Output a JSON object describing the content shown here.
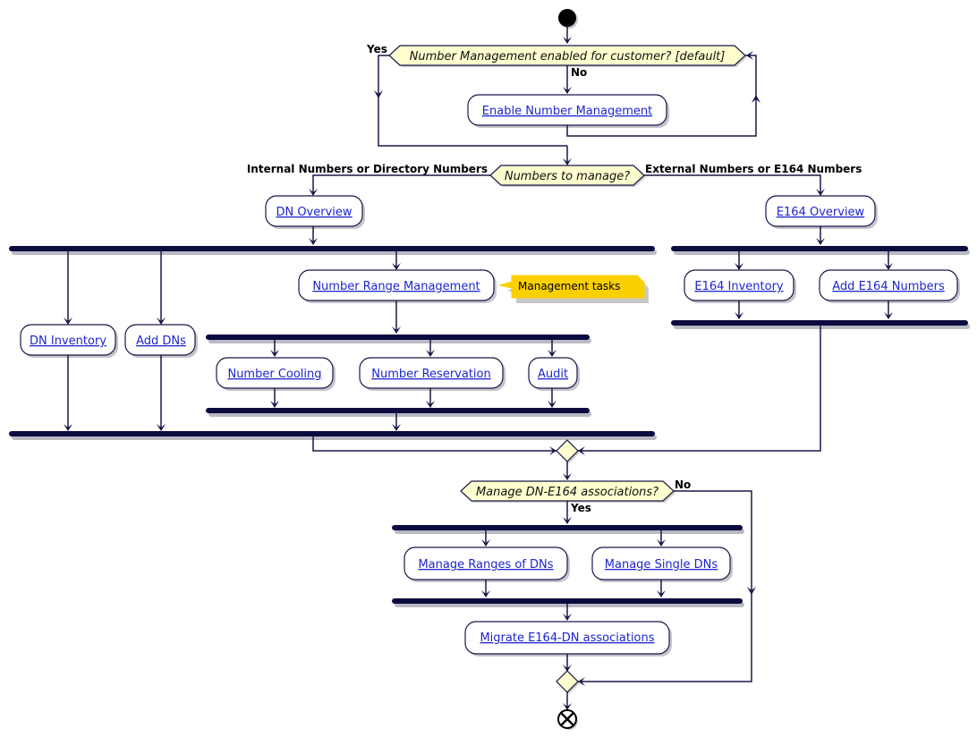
{
  "diagram": {
    "type": "activity-diagram",
    "colors": {
      "line": "#181848",
      "bar": "#0b0b3f",
      "decision_fill": "#fefece",
      "action_fill": "#ffffff",
      "link_text": "#1d25ce",
      "note_fill": "#fbd000"
    },
    "start_icon": "filled-circle-start",
    "end_icon": "circle-x-end",
    "decisions": {
      "number_management": {
        "question": "Number Management enabled for customer? [default]",
        "yes_label": "Yes",
        "no_label": "No"
      },
      "numbers_to_manage": {
        "question": "Numbers to manage?",
        "left_label": "Internal Numbers or Directory Numbers",
        "right_label": "External Numbers or E164 Numbers"
      },
      "associations": {
        "question": "Manage DN-E164 associations?",
        "yes_label": "Yes",
        "no_label": "No"
      }
    },
    "actions": {
      "enable_nm": "Enable Number Management",
      "dn_overview": "DN Overview",
      "e164_overview": "E164 Overview",
      "dn_inventory": "DN Inventory",
      "add_dns": "Add DNs",
      "number_range_mgmt": "Number Range Management",
      "number_cooling": "Number Cooling",
      "number_reservation": "Number Reservation",
      "audit": "Audit",
      "e164_inventory": "E164 Inventory",
      "add_e164": "Add E164 Numbers",
      "manage_ranges": "Manage Ranges of DNs",
      "manage_single": "Manage Single DNs",
      "migrate": "Migrate E164-DN associations"
    },
    "notes": {
      "management_tasks": "Management tasks"
    }
  }
}
